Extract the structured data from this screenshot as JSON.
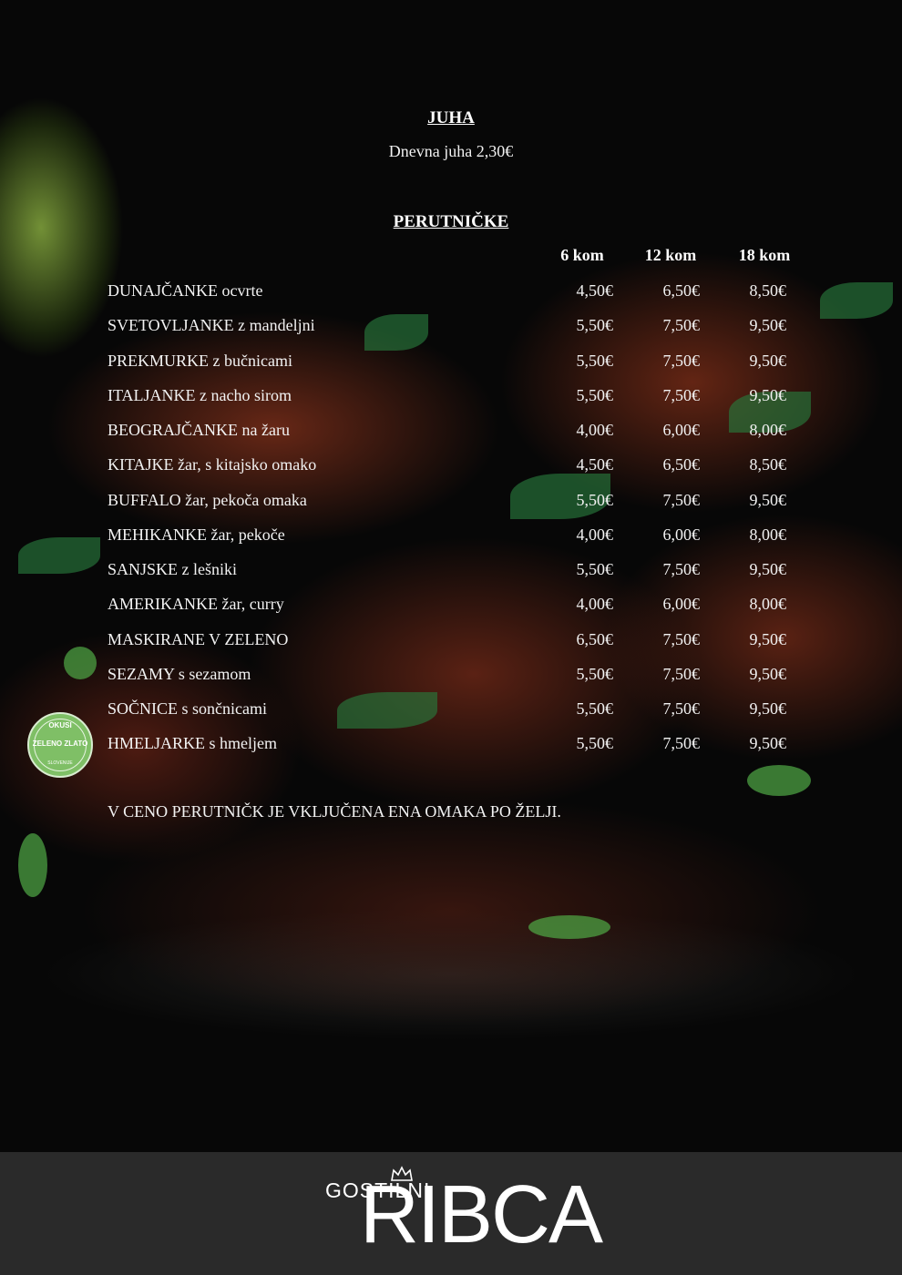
{
  "soup_section": {
    "title": "JUHA",
    "line": "Dnevna juha 2,30€"
  },
  "wings_section": {
    "title": "PERUTNIČKE",
    "columns": [
      "6 kom",
      "12 kom",
      "18 kom"
    ],
    "items": [
      {
        "name": "DUNAJČANKE ocvrte",
        "p6": "4,50€",
        "p12": "6,50€",
        "p18": "8,50€"
      },
      {
        "name": "SVETOVLJANKE z mandeljni",
        "p6": "5,50€",
        "p12": "7,50€",
        "p18": "9,50€"
      },
      {
        "name": "PREKMURKE z bučnicami",
        "p6": "5,50€",
        "p12": "7,50€",
        "p18": "9,50€"
      },
      {
        "name": "ITALJANKE z nacho sirom",
        "p6": "5,50€",
        "p12": "7,50€",
        "p18": "9,50€"
      },
      {
        "name": "BEOGRAJČANKE na žaru",
        "p6": "4,00€",
        "p12": "6,00€",
        "p18": "8,00€"
      },
      {
        "name": "KITAJKE  žar, s kitajsko omako",
        "p6": "4,50€",
        "p12": "6,50€",
        "p18": "8,50€"
      },
      {
        "name": "BUFFALO žar, pekoča omaka",
        "p6": "5,50€",
        "p12": "7,50€",
        "p18": "9,50€"
      },
      {
        "name": "MEHIKANKE žar, pekoče",
        "p6": "4,00€",
        "p12": "6,00€",
        "p18": "8,00€"
      },
      {
        "name": "SANJSKE z lešniki",
        "p6": "5,50€",
        "p12": "7,50€",
        "p18": "9,50€"
      },
      {
        "name": "AMERIKANKE žar, curry",
        "p6": "4,00€",
        "p12": "6,00€",
        "p18": "8,00€"
      },
      {
        "name": "MASKIRANE V ZELENO",
        "p6": "6,50€",
        "p12": "7,50€",
        "p18": "9,50€"
      },
      {
        "name": "SEZAMY s sezamom",
        "p6": "5,50€",
        "p12": "7,50€",
        "p18": "9,50€"
      },
      {
        "name": "SOČNICE s sončnicami",
        "p6": "5,50€",
        "p12": "7,50€",
        "p18": "9,50€"
      },
      {
        "name": "HMELJARKE s hmeljem",
        "p6": "5,50€",
        "p12": "7,50€",
        "p18": "9,50€"
      }
    ],
    "note": "V CENO PERUTNIČK JE VKLJUČENA ENA OMAKA PO ŽELJI."
  },
  "badge": {
    "top": "OKUSI",
    "middle": "ZELENO ZLATO",
    "bottom": "SLOVENIJE",
    "icon": "zeleno-zlato-seal"
  },
  "footer": {
    "logo_top": "GOSTILNI",
    "logo_main": "RIBCA",
    "icon": "crown-icon"
  },
  "colors": {
    "background": "#050505",
    "text": "#f2f2f2",
    "footer_bg": "#2a2a2a",
    "badge_green": "#7fbf66"
  }
}
